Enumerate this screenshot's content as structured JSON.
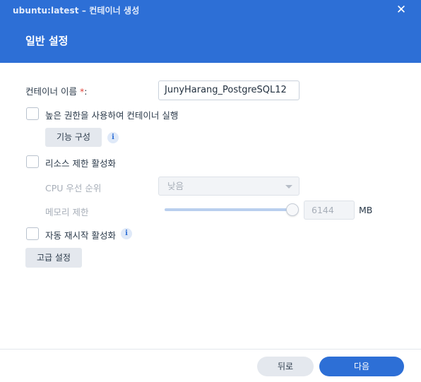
{
  "window": {
    "title": "ubuntu:latest – 컨테이너 생성",
    "close_icon": "close-icon"
  },
  "section": {
    "title": "일반 설정"
  },
  "form": {
    "container_name": {
      "label": "컨테이너 이름",
      "required_mark": "*",
      "colon": ":",
      "value": "JunyHarang_PostgreSQL12"
    },
    "privileged": {
      "label": "높은 권한을 사용하여 컨테이너 실행",
      "checked": false
    },
    "capabilities_button": "기능 구성",
    "resource_limit": {
      "label": "리소스 제한 활성화",
      "checked": false
    },
    "cpu_priority": {
      "label": "CPU 우선 순위",
      "value": "낮음"
    },
    "memory_limit": {
      "label": "메모리 제한",
      "value": "6144",
      "unit": "MB",
      "slider_level": 1.0
    },
    "auto_restart": {
      "label": "자동 재시작 활성화",
      "checked": false
    },
    "advanced_button": "고급 설정"
  },
  "footer": {
    "back_label": "뒤로",
    "next_label": "다음"
  },
  "colors": {
    "accent": "#2d6fd6",
    "required": "#e0443b",
    "button_grey": "#e4e8ee"
  }
}
